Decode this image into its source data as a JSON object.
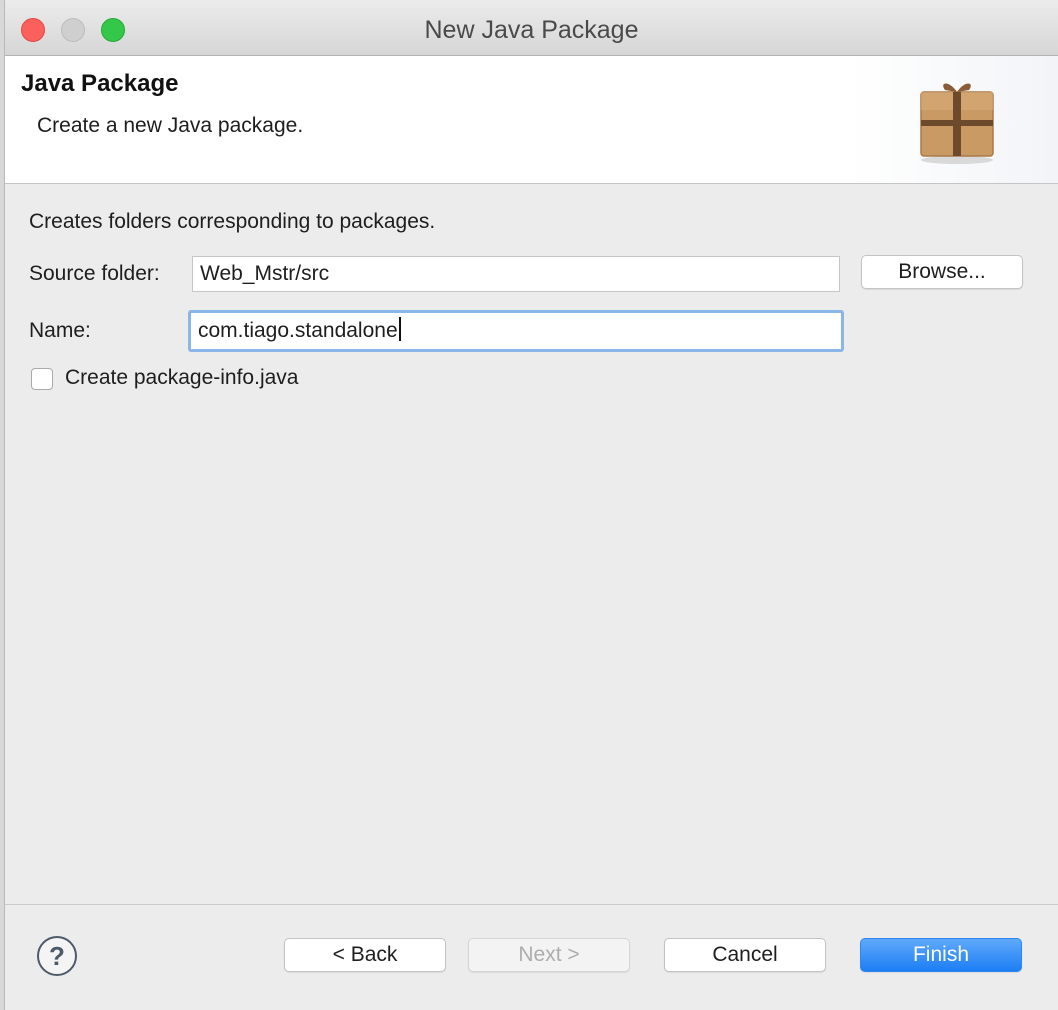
{
  "window": {
    "title": "New Java Package"
  },
  "banner": {
    "title": "Java Package",
    "description": "Create a new Java package.",
    "icon": "package-box-icon"
  },
  "form": {
    "intro": "Creates folders corresponding to packages.",
    "source_folder_label": "Source folder:",
    "source_folder_value": "Web_Mstr/src",
    "browse_label": "Browse...",
    "name_label": "Name:",
    "name_value": "com.tiago.standalone",
    "create_info_label": "Create package-info.java",
    "create_info_checked": false
  },
  "footer": {
    "help_icon": "help-icon",
    "back_label": "< Back",
    "next_label": "Next >",
    "cancel_label": "Cancel",
    "finish_label": "Finish"
  },
  "colors": {
    "accent": "#1d7ef4",
    "focus_ring": "#8ab6ea"
  }
}
